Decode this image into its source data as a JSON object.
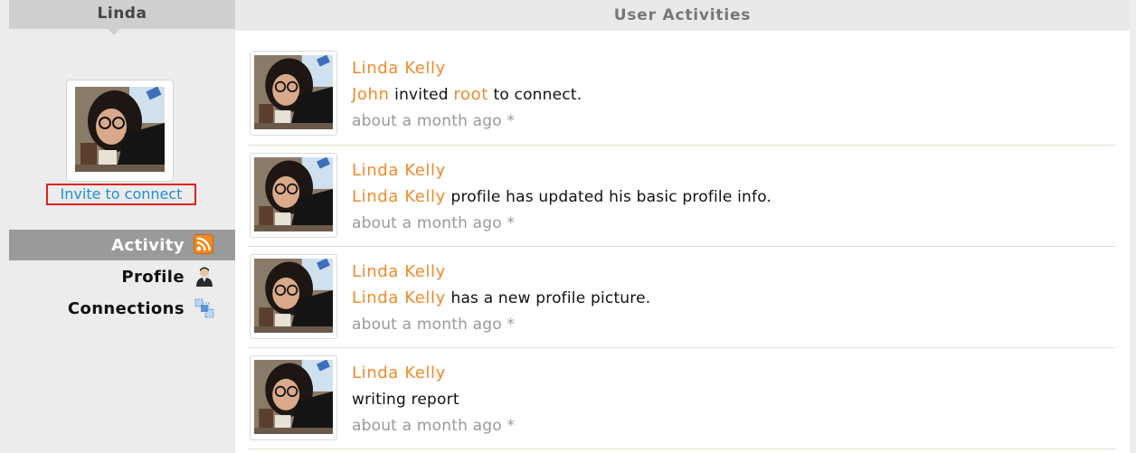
{
  "sidebar": {
    "title": "Linda",
    "invite_label": "Invite to connect",
    "nav": [
      {
        "label": "Activity",
        "icon": "rss-icon",
        "active": true
      },
      {
        "label": "Profile",
        "icon": "person-icon",
        "active": false
      },
      {
        "label": "Connections",
        "icon": "connections-icon",
        "active": false
      }
    ]
  },
  "main": {
    "title": "User Activities",
    "activities": [
      {
        "author": "Linda Kelly",
        "parts": [
          {
            "text": "John",
            "highlight": true
          },
          {
            "text": " invited ",
            "highlight": false
          },
          {
            "text": "root",
            "highlight": true
          },
          {
            "text": " to connect.",
            "highlight": false
          }
        ],
        "time": "about a month ago *"
      },
      {
        "author": "Linda Kelly",
        "parts": [
          {
            "text": "Linda Kelly",
            "highlight": true
          },
          {
            "text": " profile has updated his basic profile info.",
            "highlight": false
          }
        ],
        "time": "about a month ago *"
      },
      {
        "author": "Linda Kelly",
        "parts": [
          {
            "text": "Linda Kelly",
            "highlight": true
          },
          {
            "text": " has a new profile picture.",
            "highlight": false
          }
        ],
        "time": "about a month ago *"
      },
      {
        "author": "Linda Kelly",
        "parts": [
          {
            "text": "writing report",
            "highlight": false
          }
        ],
        "time": "about a month ago *"
      }
    ]
  },
  "colors": {
    "accent": "#ef8a2b",
    "link": "#1f8fd4",
    "active_nav": "#9a9a9a",
    "invite_border": "#e02020"
  }
}
